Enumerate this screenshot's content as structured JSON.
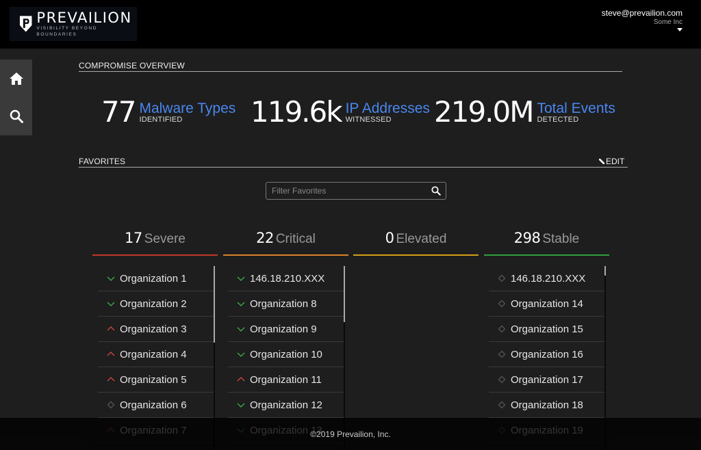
{
  "header": {
    "brand": "PREVAILION",
    "tagline": "VISIBILITY BEYOND BOUNDARIES",
    "user_email": "steve@prevailion.com",
    "user_org": "Some Inc"
  },
  "sidenav": [
    {
      "icon": "home-icon"
    },
    {
      "icon": "search-icon"
    }
  ],
  "overview": {
    "heading": "COMPROMISE OVERVIEW",
    "stats": [
      {
        "value": "77",
        "title": "Malware Types",
        "sub": "IDENTIFIED"
      },
      {
        "value": "119.6k",
        "title": "IP Addresses",
        "sub": "WITNESSED"
      },
      {
        "value": "219.0M",
        "title": "Total Events",
        "sub": "DETECTED"
      }
    ]
  },
  "favorites": {
    "heading": "FAVORITES",
    "edit_label": "EDIT",
    "filter_placeholder": "Filter Favorites"
  },
  "columns": [
    {
      "count": "17",
      "label": "Severe",
      "color": "#c0392b",
      "items": [
        {
          "name": "Organization 1",
          "trend": "down"
        },
        {
          "name": "Organization 2",
          "trend": "down"
        },
        {
          "name": "Organization 3",
          "trend": "up"
        },
        {
          "name": "Organization 4",
          "trend": "up"
        },
        {
          "name": "Organization 5",
          "trend": "up"
        },
        {
          "name": "Organization 6",
          "trend": "neutral"
        },
        {
          "name": "Organization 7",
          "trend": "up"
        }
      ]
    },
    {
      "count": "22",
      "label": "Critical",
      "color": "#d9822b",
      "items": [
        {
          "name": "146.18.210.XXX",
          "trend": "down"
        },
        {
          "name": "Organization 8",
          "trend": "down"
        },
        {
          "name": "Organization 9",
          "trend": "down"
        },
        {
          "name": "Organization 10",
          "trend": "down"
        },
        {
          "name": "Organization 11",
          "trend": "up"
        },
        {
          "name": "Organization 12",
          "trend": "down"
        },
        {
          "name": "Organization 13",
          "trend": "down"
        }
      ]
    },
    {
      "count": "0",
      "label": "Elevated",
      "color": "#d4a017",
      "items": []
    },
    {
      "count": "298",
      "label": "Stable",
      "color": "#2e9e3e",
      "items": [
        {
          "name": "146.18.210.XXX",
          "trend": "neutral"
        },
        {
          "name": "Organization 14",
          "trend": "neutral"
        },
        {
          "name": "Organization 15",
          "trend": "neutral"
        },
        {
          "name": "Organization 16",
          "trend": "neutral"
        },
        {
          "name": "Organization 17",
          "trend": "neutral"
        },
        {
          "name": "Organization 18",
          "trend": "neutral"
        },
        {
          "name": "Organization 19",
          "trend": "neutral"
        }
      ]
    }
  ],
  "footer": {
    "text": "©2019 Prevailion, Inc."
  },
  "colors": {
    "accent": "#4a86f0",
    "trend_up": "#d64545",
    "trend_down": "#3fae4f",
    "trend_neutral": "#555555"
  }
}
